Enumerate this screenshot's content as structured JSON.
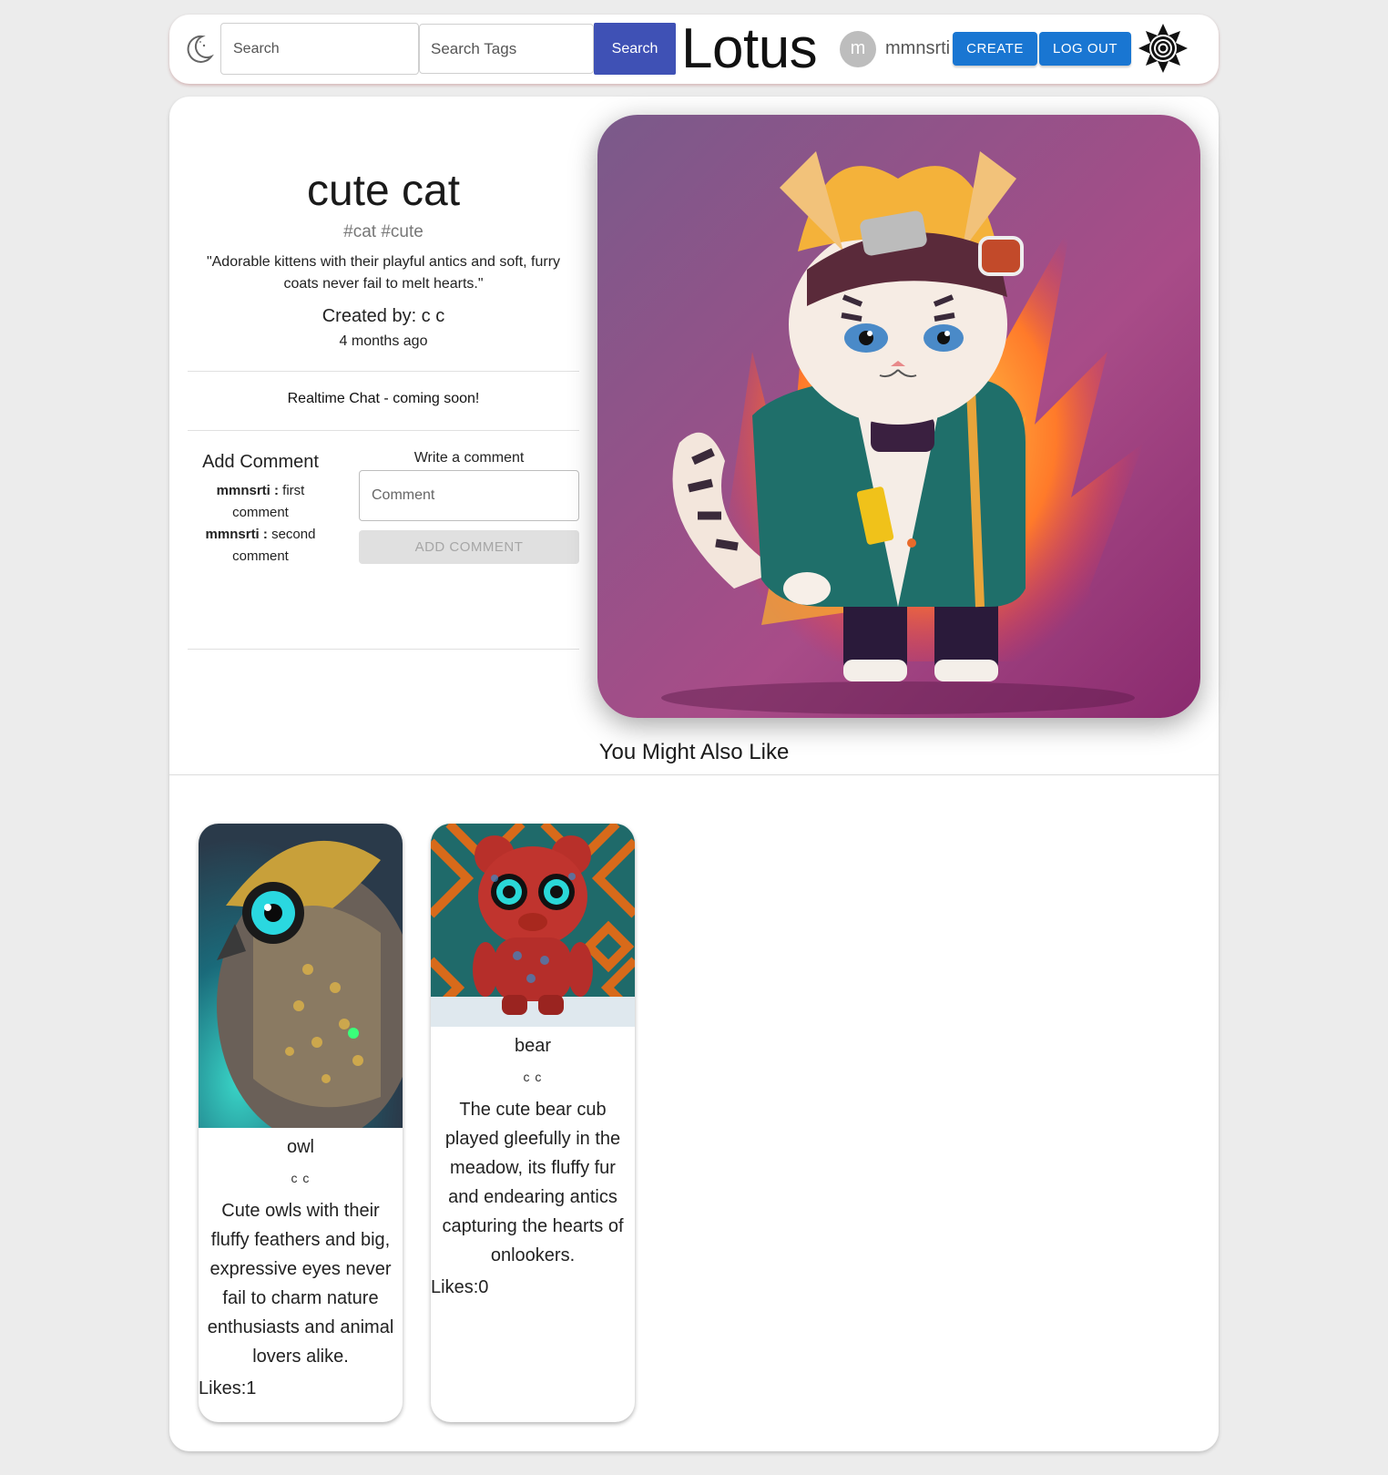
{
  "header": {
    "search_placeholder": "Search",
    "tags_placeholder": "Search Tags",
    "search_label": "Search",
    "brand": "Lotus",
    "avatar_initial": "m",
    "username": "mmnsrti",
    "create_label": "CREATE",
    "logout_label": "LOG OUT",
    "theme_icon": "moon-icon",
    "logo_icon": "lotus-logo-icon"
  },
  "post": {
    "title": "cute cat",
    "tags": "#cat #cute",
    "description": "\"Adorable kittens with their playful antics and soft, furry coats never fail to melt hearts.\"",
    "created_by": "Created by: c c",
    "time_ago": "4 months ago",
    "chat_note": "Realtime Chat - coming soon!"
  },
  "comments": {
    "heading": "Add Comment",
    "items": [
      {
        "user": "mmnsrti",
        "sep": " : ",
        "text": "first comment"
      },
      {
        "user": "mmnsrti",
        "sep": " : ",
        "text": "second comment"
      }
    ],
    "write_label": "Write a comment",
    "input_placeholder": "Comment",
    "add_label": "ADD COMMENT"
  },
  "recommendations": {
    "heading": "You Might Also Like",
    "items": [
      {
        "name": "owl",
        "author": "c c",
        "description": "Cute owls with their fluffy feathers and big, expressive eyes never fail to charm nature enthusiasts and animal lovers alike.",
        "likes_label": "Likes:",
        "likes": "1"
      },
      {
        "name": "bear",
        "author": "c c",
        "description": "The cute bear cub played gleefully in the meadow, its fluffy fur and endearing antics capturing the hearts of onlookers.",
        "likes_label": "Likes:",
        "likes": "0"
      }
    ]
  },
  "colors": {
    "primary_button": "#1976d2",
    "search_button": "#3f51b5",
    "page_background": "#ececec"
  }
}
